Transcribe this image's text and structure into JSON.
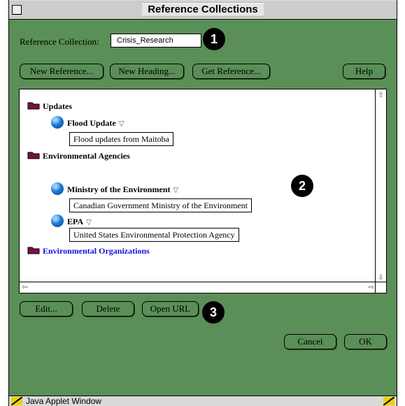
{
  "window": {
    "title": "Reference Collections"
  },
  "collection": {
    "label": "Reference Collection:",
    "value": "Crisis_Research"
  },
  "toolbar": {
    "new_reference": "New Reference...",
    "new_heading": "New Heading...",
    "get_reference": "Get Reference...",
    "help": "Help"
  },
  "tree": {
    "updates": "Updates",
    "flood_update": "Flood Update",
    "flood_update_desc": "Flood updates from Maitoba",
    "env_agencies": "Environmental Agencies",
    "ministry": "Ministry of the Environment",
    "ministry_desc": "Canadian Government Ministry of the Environment",
    "epa": "EPA",
    "epa_desc": "United States Environmental Protection Agency",
    "env_orgs": "Environmental Organizations"
  },
  "actions": {
    "edit": "Edit...",
    "delete": "Delete",
    "open_url": "Open URL"
  },
  "dialog": {
    "cancel": "Cancel",
    "ok": "OK"
  },
  "badges": {
    "one": "1",
    "two": "2",
    "three": "3"
  },
  "status": {
    "text": "Java Applet Window"
  },
  "icons": {
    "folder": "folder-icon",
    "globe": "globe-icon",
    "disclosure": "disclosure-triangle-icon",
    "scroll_up": "scroll-up-arrow-icon",
    "scroll_down": "scroll-down-arrow-icon",
    "scroll_left": "scroll-left-arrow-icon",
    "scroll_right": "scroll-right-arrow-icon",
    "close": "close-box-icon",
    "warning": "warning-icon"
  },
  "colors": {
    "window_bg": "#5a8f57",
    "link": "#1a0fd6",
    "badge_bg": "#000000"
  }
}
